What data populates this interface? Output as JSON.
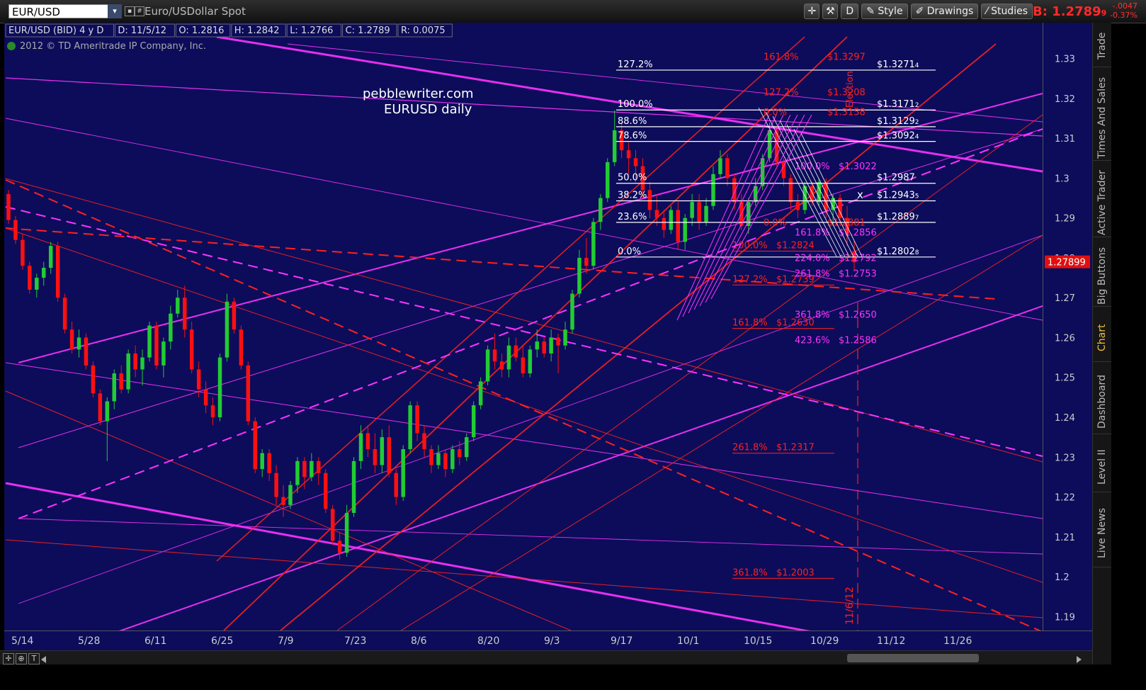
{
  "header": {
    "symbol": "EUR/USD",
    "description": "Euro/USDollar Spot",
    "toolbar": {
      "style_label": "Style",
      "drawings_label": "Drawings",
      "studies_label": "Studies",
      "mode_label": "D"
    },
    "bid": "B: 1.2789",
    "bid_sub": "9",
    "change_net": "-.0047",
    "change_pct": "-0.37%"
  },
  "info_bar": {
    "series": "EUR/USD (BID) 4 y D",
    "date": "D: 11/5/12",
    "open": "O: 1.2816",
    "high": "H: 1.2842",
    "low": "L: 1.2766",
    "close": "C: 1.2789",
    "range": "R: 0.0075",
    "copyright": "2012 © TD Ameritrade IP Company, Inc."
  },
  "annotations": {
    "watermark_line1": "pebblewriter.com",
    "watermark_line2": "EURUSD daily",
    "vertical_date": "11/6/12",
    "vertical_note": "Election"
  },
  "price_axis": {
    "ticks": [
      "1.33",
      "1.32",
      "1.31",
      "1.3",
      "1.29",
      "1.28",
      "1.27",
      "1.26",
      "1.25",
      "1.24",
      "1.23",
      "1.22",
      "1.21",
      "1.2",
      "1.19"
    ],
    "last_price": "1.27899"
  },
  "time_axis": {
    "ticks": [
      "5/14",
      "5/28",
      "6/11",
      "6/25",
      "7/9",
      "7/23",
      "8/6",
      "8/20",
      "9/3",
      "9/17",
      "10/1",
      "10/15",
      "10/29",
      "11/12",
      "11/26"
    ]
  },
  "fib_white": [
    {
      "pct": "127.2%",
      "price": "$1.3271",
      "sub": "4"
    },
    {
      "pct": "100.0%",
      "price": "$1.3171",
      "sub": "2"
    },
    {
      "pct": "88.6%",
      "price": "$1.3129",
      "sub": "2"
    },
    {
      "pct": "78.6%",
      "price": "$1.3092",
      "sub": "4"
    },
    {
      "pct": "50.0%",
      "price": "$1.2987",
      "sub": ""
    },
    {
      "pct": "38.2%",
      "price": "$1.2943",
      "sub": "5"
    },
    {
      "pct": "23.6%",
      "price": "$1.2889",
      "sub": "7"
    },
    {
      "pct": "0.0%",
      "price": "$1.2802",
      "sub": "8"
    }
  ],
  "fib_red_left": [
    {
      "pct": "100.0%",
      "price": "$1.2824"
    },
    {
      "pct": "127.2%",
      "price": "$1.2739"
    },
    {
      "pct": "161.8%",
      "price": "$1.2630"
    },
    {
      "pct": "261.8%",
      "price": "$1.2317"
    },
    {
      "pct": "361.8%",
      "price": "$1.2003"
    }
  ],
  "fib_red_top": [
    {
      "pct": "161.8%",
      "price": "$1.3297"
    },
    {
      "pct": "127.2%",
      "price": "$1.3208"
    },
    {
      "pct": "0.0%",
      "price": "$1.3158"
    },
    {
      "pct": "0.0%",
      "price": "$1.2881"
    }
  ],
  "fib_magenta": [
    {
      "pct": "100.0%",
      "price": "$1.3022"
    },
    {
      "pct": "161.8%",
      "price": "$1.2856"
    },
    {
      "pct": "224.0%",
      "price": "$1.2792"
    },
    {
      "pct": "261.8%",
      "price": "$1.2753"
    },
    {
      "pct": "361.8%",
      "price": "$1.2650"
    },
    {
      "pct": "423.6%",
      "price": "$1.2586"
    }
  ],
  "colors": {
    "background": "#0c0c5a",
    "up": "#22cc33",
    "down": "#ff1010",
    "magenta": "#ff33ff",
    "red": "#ff2020",
    "fib_white": "#ffffff"
  },
  "right_tabs": [
    "Trade",
    "Times And Sales",
    "Active Trader",
    "Big Buttons",
    "Chart",
    "Dashboard",
    "Level II",
    "Live News"
  ],
  "candles": [
    [
      1.296,
      1.297,
      1.2885,
      1.2895
    ],
    [
      1.2895,
      1.2905,
      1.2835,
      1.2845
    ],
    [
      1.2845,
      1.286,
      1.277,
      1.278
    ],
    [
      1.278,
      1.279,
      1.271,
      1.272
    ],
    [
      1.272,
      1.276,
      1.27,
      1.275
    ],
    [
      1.275,
      1.279,
      1.273,
      1.2775
    ],
    [
      1.2775,
      1.284,
      1.276,
      1.283
    ],
    [
      1.283,
      1.284,
      1.269,
      1.27
    ],
    [
      1.27,
      1.271,
      1.261,
      1.262
    ],
    [
      1.262,
      1.264,
      1.256,
      1.257
    ],
    [
      1.257,
      1.262,
      1.255,
      1.26
    ],
    [
      1.26,
      1.261,
      1.252,
      1.253
    ],
    [
      1.253,
      1.254,
      1.245,
      1.246
    ],
    [
      1.246,
      1.247,
      1.238,
      1.239
    ],
    [
      1.239,
      1.245,
      1.229,
      1.244
    ],
    [
      1.244,
      1.252,
      1.242,
      1.251
    ],
    [
      1.251,
      1.253,
      1.246,
      1.247
    ],
    [
      1.247,
      1.257,
      1.246,
      1.256
    ],
    [
      1.256,
      1.258,
      1.25,
      1.252
    ],
    [
      1.252,
      1.257,
      1.248,
      1.255
    ],
    [
      1.255,
      1.264,
      1.254,
      1.263
    ],
    [
      1.263,
      1.264,
      1.252,
      1.253
    ],
    [
      1.253,
      1.26,
      1.25,
      1.259
    ],
    [
      1.259,
      1.268,
      1.257,
      1.266
    ],
    [
      1.266,
      1.272,
      1.265,
      1.27
    ],
    [
      1.27,
      1.273,
      1.26,
      1.262
    ],
    [
      1.262,
      1.264,
      1.251,
      1.252
    ],
    [
      1.252,
      1.254,
      1.245,
      1.247
    ],
    [
      1.247,
      1.249,
      1.241,
      1.243
    ],
    [
      1.243,
      1.245,
      1.238,
      1.24
    ],
    [
      1.24,
      1.256,
      1.239,
      1.255
    ],
    [
      1.255,
      1.271,
      1.254,
      1.269
    ],
    [
      1.269,
      1.27,
      1.261,
      1.262
    ],
    [
      1.262,
      1.263,
      1.252,
      1.253
    ],
    [
      1.253,
      1.254,
      1.238,
      1.239
    ],
    [
      1.239,
      1.24,
      1.226,
      1.227
    ],
    [
      1.227,
      1.232,
      1.225,
      1.231
    ],
    [
      1.231,
      1.232,
      1.224,
      1.226
    ],
    [
      1.226,
      1.228,
      1.218,
      1.22
    ],
    [
      1.22,
      1.223,
      1.215,
      1.218
    ],
    [
      1.218,
      1.224,
      1.217,
      1.223
    ],
    [
      1.223,
      1.23,
      1.221,
      1.229
    ],
    [
      1.229,
      1.23,
      1.222,
      1.225
    ],
    [
      1.225,
      1.231,
      1.224,
      1.229
    ],
    [
      1.229,
      1.23,
      1.223,
      1.226
    ],
    [
      1.226,
      1.227,
      1.216,
      1.217
    ],
    [
      1.217,
      1.218,
      1.208,
      1.209
    ],
    [
      1.209,
      1.211,
      1.2043,
      1.206
    ],
    [
      1.206,
      1.218,
      1.205,
      1.216
    ],
    [
      1.216,
      1.23,
      1.215,
      1.229
    ],
    [
      1.229,
      1.238,
      1.227,
      1.236
    ],
    [
      1.236,
      1.238,
      1.23,
      1.232
    ],
    [
      1.232,
      1.236,
      1.226,
      1.228
    ],
    [
      1.228,
      1.237,
      1.226,
      1.235
    ],
    [
      1.235,
      1.238,
      1.225,
      1.226
    ],
    [
      1.226,
      1.227,
      1.218,
      1.22
    ],
    [
      1.22,
      1.233,
      1.219,
      1.232
    ],
    [
      1.232,
      1.244,
      1.231,
      1.243
    ],
    [
      1.243,
      1.244,
      1.234,
      1.236
    ],
    [
      1.236,
      1.238,
      1.23,
      1.232
    ],
    [
      1.232,
      1.233,
      1.226,
      1.228
    ],
    [
      1.228,
      1.233,
      1.227,
      1.231
    ],
    [
      1.231,
      1.232,
      1.225,
      1.227
    ],
    [
      1.227,
      1.233,
      1.226,
      1.232
    ],
    [
      1.232,
      1.234,
      1.228,
      1.23
    ],
    [
      1.23,
      1.236,
      1.229,
      1.235
    ],
    [
      1.235,
      1.244,
      1.234,
      1.243
    ],
    [
      1.243,
      1.25,
      1.242,
      1.249
    ],
    [
      1.249,
      1.258,
      1.248,
      1.257
    ],
    [
      1.257,
      1.261,
      1.252,
      1.254
    ],
    [
      1.254,
      1.256,
      1.25,
      1.252
    ],
    [
      1.252,
      1.26,
      1.25,
      1.258
    ],
    [
      1.258,
      1.26,
      1.254,
      1.255
    ],
    [
      1.255,
      1.258,
      1.25,
      1.251
    ],
    [
      1.251,
      1.258,
      1.25,
      1.257
    ],
    [
      1.257,
      1.262,
      1.255,
      1.259
    ],
    [
      1.259,
      1.26,
      1.255,
      1.256
    ],
    [
      1.256,
      1.262,
      1.254,
      1.26
    ],
    [
      1.26,
      1.261,
      1.251,
      1.258
    ],
    [
      1.258,
      1.264,
      1.257,
      1.262
    ],
    [
      1.262,
      1.272,
      1.261,
      1.271
    ],
    [
      1.271,
      1.282,
      1.27,
      1.28
    ],
    [
      1.28,
      1.285,
      1.276,
      1.278
    ],
    [
      1.278,
      1.29,
      1.277,
      1.289
    ],
    [
      1.289,
      1.296,
      1.287,
      1.295
    ],
    [
      1.295,
      1.305,
      1.294,
      1.304
    ],
    [
      1.304,
      1.317,
      1.303,
      1.312
    ],
    [
      1.312,
      1.314,
      1.305,
      1.307
    ],
    [
      1.307,
      1.309,
      1.301,
      1.305
    ],
    [
      1.305,
      1.307,
      1.299,
      1.303
    ],
    [
      1.303,
      1.305,
      1.295,
      1.297
    ],
    [
      1.297,
      1.299,
      1.29,
      1.292
    ],
    [
      1.292,
      1.296,
      1.288,
      1.29
    ],
    [
      1.29,
      1.292,
      1.285,
      1.287
    ],
    [
      1.287,
      1.293,
      1.286,
      1.292
    ],
    [
      1.292,
      1.294,
      1.282,
      1.284
    ],
    [
      1.284,
      1.291,
      1.282,
      1.29
    ],
    [
      1.29,
      1.296,
      1.288,
      1.294
    ],
    [
      1.294,
      1.296,
      1.287,
      1.289
    ],
    [
      1.289,
      1.295,
      1.288,
      1.293
    ],
    [
      1.293,
      1.303,
      1.292,
      1.301
    ],
    [
      1.301,
      1.307,
      1.3,
      1.305
    ],
    [
      1.305,
      1.306,
      1.298,
      1.3
    ],
    [
      1.3,
      1.301,
      1.292,
      1.294
    ],
    [
      1.294,
      1.296,
      1.287,
      1.288
    ],
    [
      1.288,
      1.295,
      1.286,
      1.294
    ],
    [
      1.294,
      1.3,
      1.293,
      1.298
    ],
    [
      1.298,
      1.306,
      1.297,
      1.305
    ],
    [
      1.305,
      1.314,
      1.304,
      1.312
    ],
    [
      1.312,
      1.313,
      1.303,
      1.304
    ],
    [
      1.304,
      1.305,
      1.298,
      1.3
    ],
    [
      1.3,
      1.301,
      1.292,
      1.294
    ],
    [
      1.294,
      1.296,
      1.29,
      1.292
    ],
    [
      1.292,
      1.299,
      1.291,
      1.298
    ],
    [
      1.298,
      1.299,
      1.293,
      1.294
    ],
    [
      1.294,
      1.3,
      1.293,
      1.299
    ],
    [
      1.299,
      1.3,
      1.29,
      1.292
    ],
    [
      1.292,
      1.296,
      1.288,
      1.295
    ],
    [
      1.295,
      1.296,
      1.288,
      1.29
    ],
    [
      1.29,
      1.293,
      1.283,
      1.286
    ],
    [
      1.2816,
      1.2842,
      1.2766,
      1.2789
    ]
  ]
}
